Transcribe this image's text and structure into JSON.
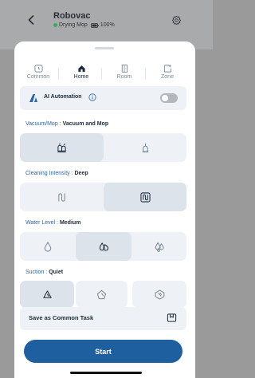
{
  "header": {
    "title": "Robovac",
    "status_text": "Drying Mop",
    "battery_text": "100%",
    "status_color": "#2fb35a",
    "back_icon": "chevron-left-icon",
    "settings_icon": "gear-icon"
  },
  "tabs": [
    {
      "label": "Common",
      "icon": "clock-icon",
      "active": false
    },
    {
      "label": "Home",
      "icon": "house-icon",
      "active": true
    },
    {
      "label": "Room",
      "icon": "door-icon",
      "active": false
    },
    {
      "label": "Zone",
      "icon": "zone-plus-icon",
      "active": false
    }
  ],
  "ai_automation": {
    "label": "AI Automation",
    "enabled": false,
    "logo_icon": "ai-logo-icon",
    "info_icon": "info-icon"
  },
  "vacuum_mop": {
    "label": "Vacuum/Mop :",
    "value": "Vacuum and Mop",
    "options": [
      {
        "icon": "vacuum-and-mop-icon",
        "selected": true
      },
      {
        "icon": "vacuum-only-icon",
        "selected": false
      }
    ]
  },
  "cleaning_intensity": {
    "label": "Cleaning Intensity :",
    "value": "Deep",
    "options": [
      {
        "icon": "standard-path-icon",
        "selected": false
      },
      {
        "icon": "deep-path-icon",
        "selected": true
      }
    ]
  },
  "water_level": {
    "label": "Water Level :",
    "value": "Medium",
    "options": [
      {
        "icon": "water-low-icon",
        "selected": false
      },
      {
        "icon": "water-medium-icon",
        "selected": true
      },
      {
        "icon": "water-high-icon",
        "selected": false
      }
    ]
  },
  "suction": {
    "label": "Suction :",
    "value": "Quiet",
    "options": [
      {
        "icon": "suction-quiet-icon",
        "selected": true
      },
      {
        "icon": "suction-standard-icon",
        "selected": false
      },
      {
        "icon": "suction-turbo-icon",
        "selected": false
      }
    ]
  },
  "save_task": {
    "label": "Save as Common Task",
    "icon": "save-task-icon"
  },
  "start_button": {
    "label": "Start",
    "color": "#1e5fa0"
  }
}
